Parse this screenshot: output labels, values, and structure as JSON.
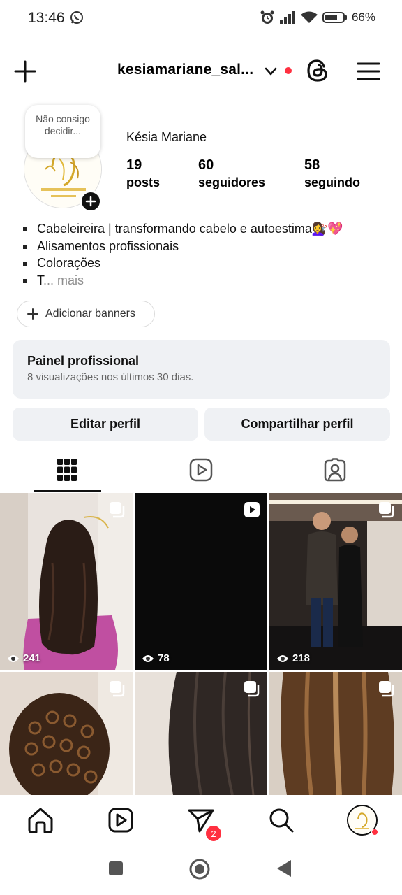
{
  "status_bar": {
    "time": "13:46",
    "battery": "66%",
    "icons": [
      "whatsapp-icon",
      "alarm-icon",
      "signal-icon",
      "wifi-icon",
      "battery-icon"
    ]
  },
  "header": {
    "username": "kesiamariane_sal...",
    "icons": [
      "plus-icon",
      "chevron-down-icon",
      "threads-icon",
      "hamburger-menu-icon"
    ],
    "notification_dot_color": "#ff3040"
  },
  "profile": {
    "note": "Não consigo decidir...",
    "display_name": "Késia Mariane",
    "stats": [
      {
        "value": "19",
        "label": "posts"
      },
      {
        "value": "60",
        "label": "seguidores"
      },
      {
        "value": "58",
        "label": "seguindo"
      }
    ],
    "bio": [
      "Cabeleireira | transformando cabelo e autoestima💇‍♀️💖",
      "Alisamentos profissionais",
      "Colorações",
      "T"
    ],
    "bio_more": "... mais",
    "banner_button": "Adicionar banners"
  },
  "panel": {
    "title": "Painel profissional",
    "subtitle": "8 visualizações nos últimos 30 dias."
  },
  "actions": {
    "edit": "Editar perfil",
    "share": "Compartilhar perfil"
  },
  "tabs": [
    "grid-icon",
    "reels-icon",
    "tagged-icon"
  ],
  "posts": [
    {
      "views": "241",
      "type": "carousel"
    },
    {
      "views": "78",
      "type": "reel"
    },
    {
      "views": "218",
      "type": "carousel"
    },
    {
      "views": "",
      "type": "carousel"
    },
    {
      "views": "",
      "type": "carousel"
    },
    {
      "views": "",
      "type": "carousel"
    }
  ],
  "bottom_nav": {
    "items": [
      "home-icon",
      "reels-icon",
      "direct-icon",
      "search-icon",
      "profile-avatar"
    ],
    "direct_badge": "2"
  },
  "colors": {
    "accent_red": "#ff3040",
    "panel_bg": "#eff1f4"
  }
}
